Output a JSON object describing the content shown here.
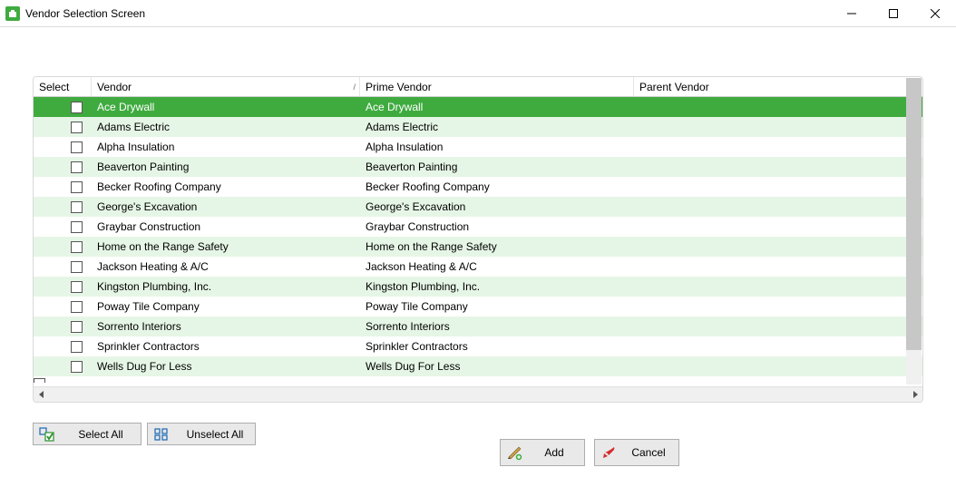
{
  "window": {
    "title": "Vendor Selection Screen"
  },
  "grid": {
    "columns": {
      "select": "Select",
      "vendor": "Vendor",
      "prime": "Prime Vendor",
      "parent": "Parent Vendor"
    },
    "sort_indicator": "▲",
    "rows": [
      {
        "vendor": "Ace Drywall",
        "prime": "Ace Drywall",
        "parent": "",
        "selected": true
      },
      {
        "vendor": "Adams Electric",
        "prime": "Adams Electric",
        "parent": ""
      },
      {
        "vendor": "Alpha Insulation",
        "prime": "Alpha Insulation",
        "parent": ""
      },
      {
        "vendor": "Beaverton Painting",
        "prime": "Beaverton Painting",
        "parent": ""
      },
      {
        "vendor": "Becker Roofing Company",
        "prime": "Becker Roofing Company",
        "parent": ""
      },
      {
        "vendor": "George's Excavation",
        "prime": "George's Excavation",
        "parent": ""
      },
      {
        "vendor": "Graybar Construction",
        "prime": "Graybar Construction",
        "parent": ""
      },
      {
        "vendor": "Home on the Range Safety",
        "prime": "Home on the Range Safety",
        "parent": ""
      },
      {
        "vendor": "Jackson Heating & A/C",
        "prime": "Jackson Heating & A/C",
        "parent": ""
      },
      {
        "vendor": "Kingston Plumbing, Inc.",
        "prime": "Kingston Plumbing, Inc.",
        "parent": ""
      },
      {
        "vendor": "Poway Tile Company",
        "prime": "Poway Tile Company",
        "parent": ""
      },
      {
        "vendor": "Sorrento Interiors",
        "prime": "Sorrento Interiors",
        "parent": ""
      },
      {
        "vendor": "Sprinkler Contractors",
        "prime": "Sprinkler Contractors",
        "parent": ""
      },
      {
        "vendor": "Wells Dug For Less",
        "prime": "Wells Dug For Less",
        "parent": ""
      }
    ]
  },
  "buttons": {
    "select_all": "Select All",
    "unselect_all": "Unselect All",
    "add": "Add",
    "cancel": "Cancel"
  }
}
